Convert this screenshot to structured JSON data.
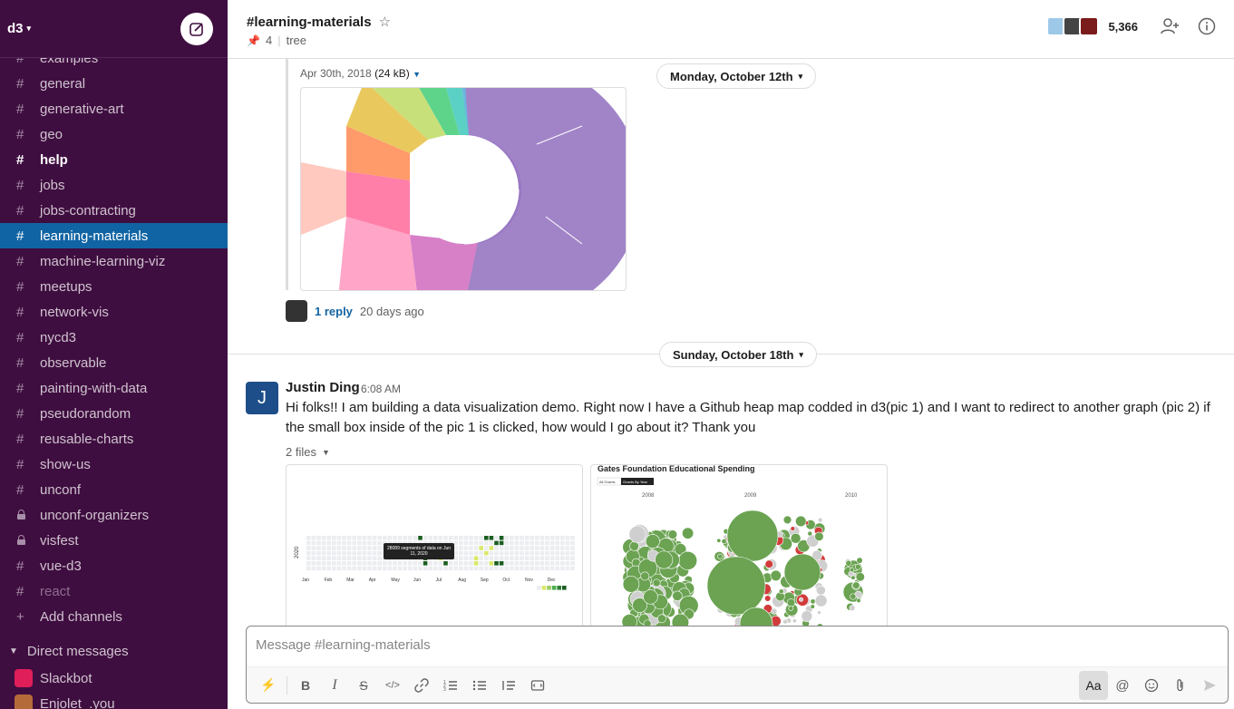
{
  "workspace": {
    "name": "d3"
  },
  "sidebar": {
    "channels": [
      {
        "label": "examples",
        "type": "public",
        "state": "partial"
      },
      {
        "label": "general",
        "type": "public",
        "state": "normal"
      },
      {
        "label": "generative-art",
        "type": "public",
        "state": "normal"
      },
      {
        "label": "geo",
        "type": "public",
        "state": "normal"
      },
      {
        "label": "help",
        "type": "public",
        "state": "unread"
      },
      {
        "label": "jobs",
        "type": "public",
        "state": "normal"
      },
      {
        "label": "jobs-contracting",
        "type": "public",
        "state": "normal"
      },
      {
        "label": "learning-materials",
        "type": "public",
        "state": "active"
      },
      {
        "label": "machine-learning-viz",
        "type": "public",
        "state": "normal"
      },
      {
        "label": "meetups",
        "type": "public",
        "state": "normal"
      },
      {
        "label": "network-vis",
        "type": "public",
        "state": "normal"
      },
      {
        "label": "nycd3",
        "type": "public",
        "state": "normal"
      },
      {
        "label": "observable",
        "type": "public",
        "state": "normal"
      },
      {
        "label": "painting-with-data",
        "type": "public",
        "state": "normal"
      },
      {
        "label": "pseudorandom",
        "type": "public",
        "state": "normal"
      },
      {
        "label": "reusable-charts",
        "type": "public",
        "state": "normal"
      },
      {
        "label": "show-us",
        "type": "public",
        "state": "normal"
      },
      {
        "label": "unconf",
        "type": "public",
        "state": "normal"
      },
      {
        "label": "unconf-organizers",
        "type": "private",
        "state": "normal"
      },
      {
        "label": "visfest",
        "type": "private",
        "state": "normal"
      },
      {
        "label": "vue-d3",
        "type": "public",
        "state": "normal"
      },
      {
        "label": "react",
        "type": "public",
        "state": "muted"
      }
    ],
    "add_channels": "Add channels",
    "dm_section": "Direct messages",
    "dms": [
      {
        "label": "Slackbot"
      },
      {
        "label": "Enjolet_.you"
      }
    ]
  },
  "header": {
    "channel_title": "#learning-materials",
    "pinned_count": "4",
    "topic": "tree",
    "member_count": "5,366"
  },
  "messages": {
    "prev_file_date": "Apr 30th, 2018",
    "prev_file_size": "(24 kB)",
    "reply_link": "1 reply",
    "reply_time": "20 days ago",
    "date_divider_1": "Monday, October 12th",
    "date_divider_2": "Sunday, October 18th",
    "author": "Justin Ding",
    "author_initial": "J",
    "time": "6:08 AM",
    "text": "Hi folks!! I am building a data visualization demo. Right now I have a Github heap map codded in d3(pic 1) and I want to redirect to another graph (pic 2) if the small box inside of the pic 1 is clicked, how would I go about it? Thank you",
    "files_label": "2 files",
    "pic1": {
      "tooltip": "28089 segments of data on Jun 11, 2020",
      "year": "2020",
      "months": [
        "Jan",
        "Feb",
        "Mar",
        "Apr",
        "May",
        "Jun",
        "Jul",
        "Aug",
        "Sep",
        "Oct",
        "Nov",
        "Dec"
      ]
    },
    "pic2": {
      "title": "Gates Foundation Educational Spending",
      "btn_all": "All Grants",
      "btn_year": "Grants By Year",
      "years": [
        "2008",
        "2009",
        "2010"
      ]
    }
  },
  "composer": {
    "placeholder": "Message #learning-materials"
  },
  "colors": {
    "sidebar_bg": "#3f0e40",
    "active_bg": "#1164a3",
    "link": "#1264a3"
  }
}
